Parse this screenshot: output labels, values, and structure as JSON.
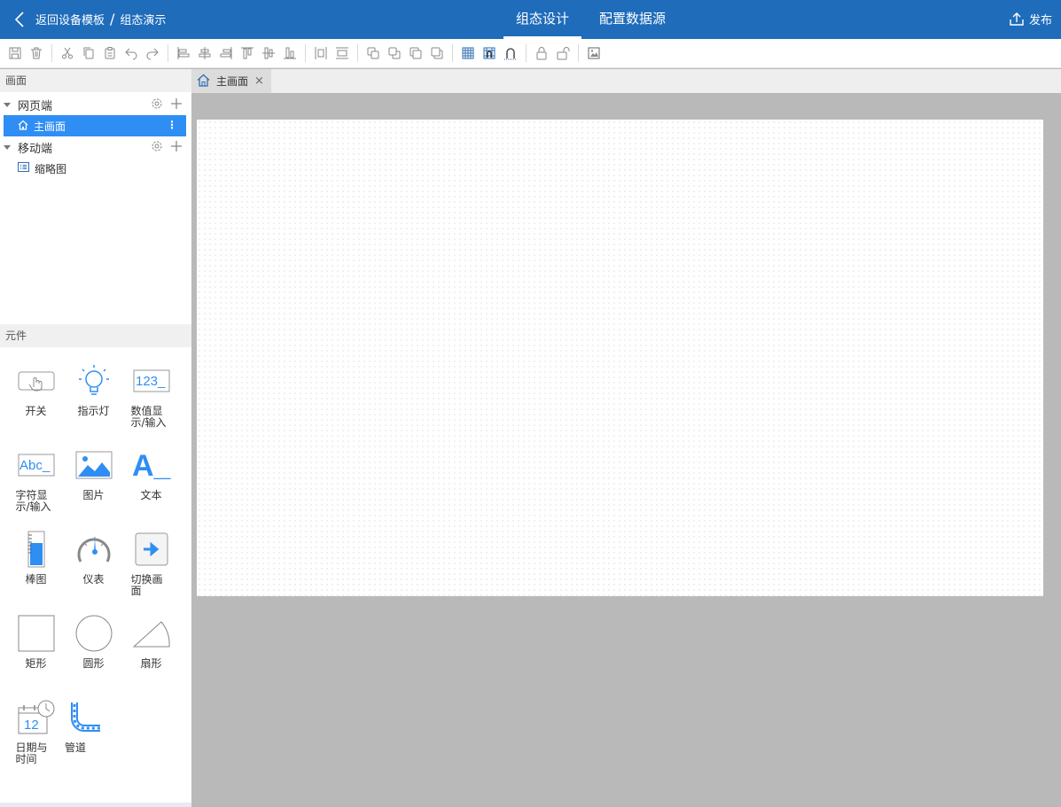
{
  "header": {
    "back_label": "返回设备模板",
    "separator": "/",
    "page_name": "组态演示",
    "tabs": [
      {
        "label": "组态设计",
        "active": true
      },
      {
        "label": "配置数据源",
        "active": false
      }
    ],
    "publish_label": "发布"
  },
  "toolbar": {
    "groups": [
      [
        "save-icon",
        "delete-icon"
      ],
      [
        "cut-icon",
        "copy-icon",
        "paste-icon",
        "undo-icon",
        "redo-icon"
      ],
      [
        "align-left-icon",
        "align-center-icon",
        "align-right-icon",
        "align-top-icon",
        "align-middle-icon",
        "align-bottom-icon"
      ],
      [
        "distribute-horizontal-icon",
        "distribute-vertical-icon"
      ],
      [
        "bring-front-icon",
        "send-back-icon",
        "bring-forward-icon",
        "send-backward-icon"
      ],
      [
        "grid-icon",
        "snap-grid-icon",
        "magnet-icon"
      ],
      [
        "lock-icon",
        "unlock-icon"
      ],
      [
        "background-image-icon"
      ]
    ]
  },
  "screens": {
    "title": "画面",
    "web": {
      "label": "网页端"
    },
    "main_screen": {
      "label": "主画面"
    },
    "mobile": {
      "label": "移动端"
    },
    "thumbnail": {
      "label": "缩略图"
    }
  },
  "components": {
    "title": "元件",
    "items": [
      {
        "label": "开关",
        "icon": "switch-icon"
      },
      {
        "label": "指示灯",
        "icon": "indicator-light-icon"
      },
      {
        "label": "数值显示/输入",
        "icon": "numeric-display-icon",
        "icon_text": "123_"
      },
      {
        "label": "字符显示/输入",
        "icon": "text-input-icon",
        "icon_text": "Abc_"
      },
      {
        "label": "图片",
        "icon": "image-icon"
      },
      {
        "label": "文本",
        "icon": "text-icon",
        "icon_text": "A_"
      },
      {
        "label": "棒图",
        "icon": "bar-gauge-icon"
      },
      {
        "label": "仪表",
        "icon": "meter-icon"
      },
      {
        "label": "切换画面",
        "icon": "switch-screen-icon"
      },
      {
        "label": "矩形",
        "icon": "rectangle-icon"
      },
      {
        "label": "圆形",
        "icon": "circle-icon"
      },
      {
        "label": "扇形",
        "icon": "sector-icon"
      },
      {
        "label": "日期与时间",
        "icon": "calendar-clock-icon",
        "icon_text": "12"
      },
      {
        "label": "管道",
        "icon": "pipe-icon"
      }
    ]
  },
  "doc_tabs": [
    {
      "label": "主画面",
      "icon": "home-icon",
      "close": "×"
    }
  ],
  "colors": {
    "header": "#1f6cbb",
    "accent": "#2f8ef4",
    "canvas_bg": "#b9b9b9"
  }
}
